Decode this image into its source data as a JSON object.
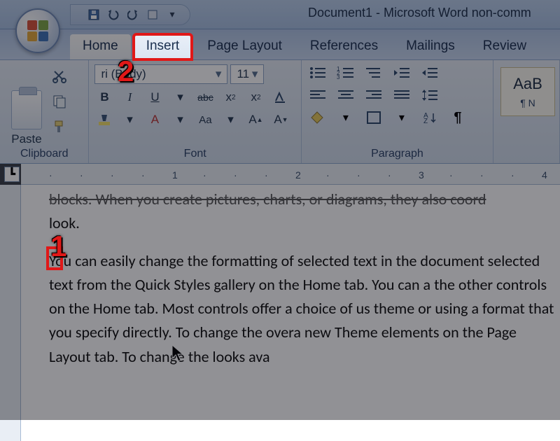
{
  "window": {
    "title": "Document1 - Microsoft Word non-comm"
  },
  "qat": {
    "items": [
      "save-icon",
      "undo-icon",
      "redo-icon",
      "repeat-icon",
      "customize-icon"
    ]
  },
  "tabs": {
    "items": [
      {
        "id": "home",
        "label": "Home"
      },
      {
        "id": "insert",
        "label": "Insert"
      },
      {
        "id": "page-layout",
        "label": "Page Layout"
      },
      {
        "id": "references",
        "label": "References"
      },
      {
        "id": "mailings",
        "label": "Mailings"
      },
      {
        "id": "review",
        "label": "Review"
      }
    ],
    "active": "home",
    "highlighted": "insert"
  },
  "annotations": {
    "one": "1",
    "two": "2"
  },
  "ribbon": {
    "clipboard": {
      "label": "Clipboard",
      "paste": "Paste"
    },
    "font": {
      "label": "Font",
      "font_name": "ri (Body)",
      "font_size": "11",
      "bold": "B",
      "italic": "I",
      "underline": "U",
      "strike": "abc",
      "sub": "x",
      "sup": "x",
      "clear": "A"
    },
    "paragraph": {
      "label": "Paragraph"
    },
    "styles": {
      "sample": "AaB",
      "name": "¶ N"
    }
  },
  "ruler": {
    "h": [
      "·",
      "·",
      "·",
      "·",
      "1",
      "·",
      "·",
      "·",
      "2",
      "·",
      "·",
      "·",
      "3",
      "·",
      "·",
      "·",
      "4"
    ]
  },
  "document": {
    "p1_tail": "look.",
    "p1_lead": "blocks. When you create pictures, charts, or diagrams, they also coord",
    "p2": "You can easily change the formatting of selected text in the document selected text from the Quick Styles gallery on the Home tab. You can a the other controls on the Home tab. Most controls offer a choice of us theme or using a format that you specify directly. To change the overa new Theme elements on the Page Layout tab. To change the looks ava"
  }
}
